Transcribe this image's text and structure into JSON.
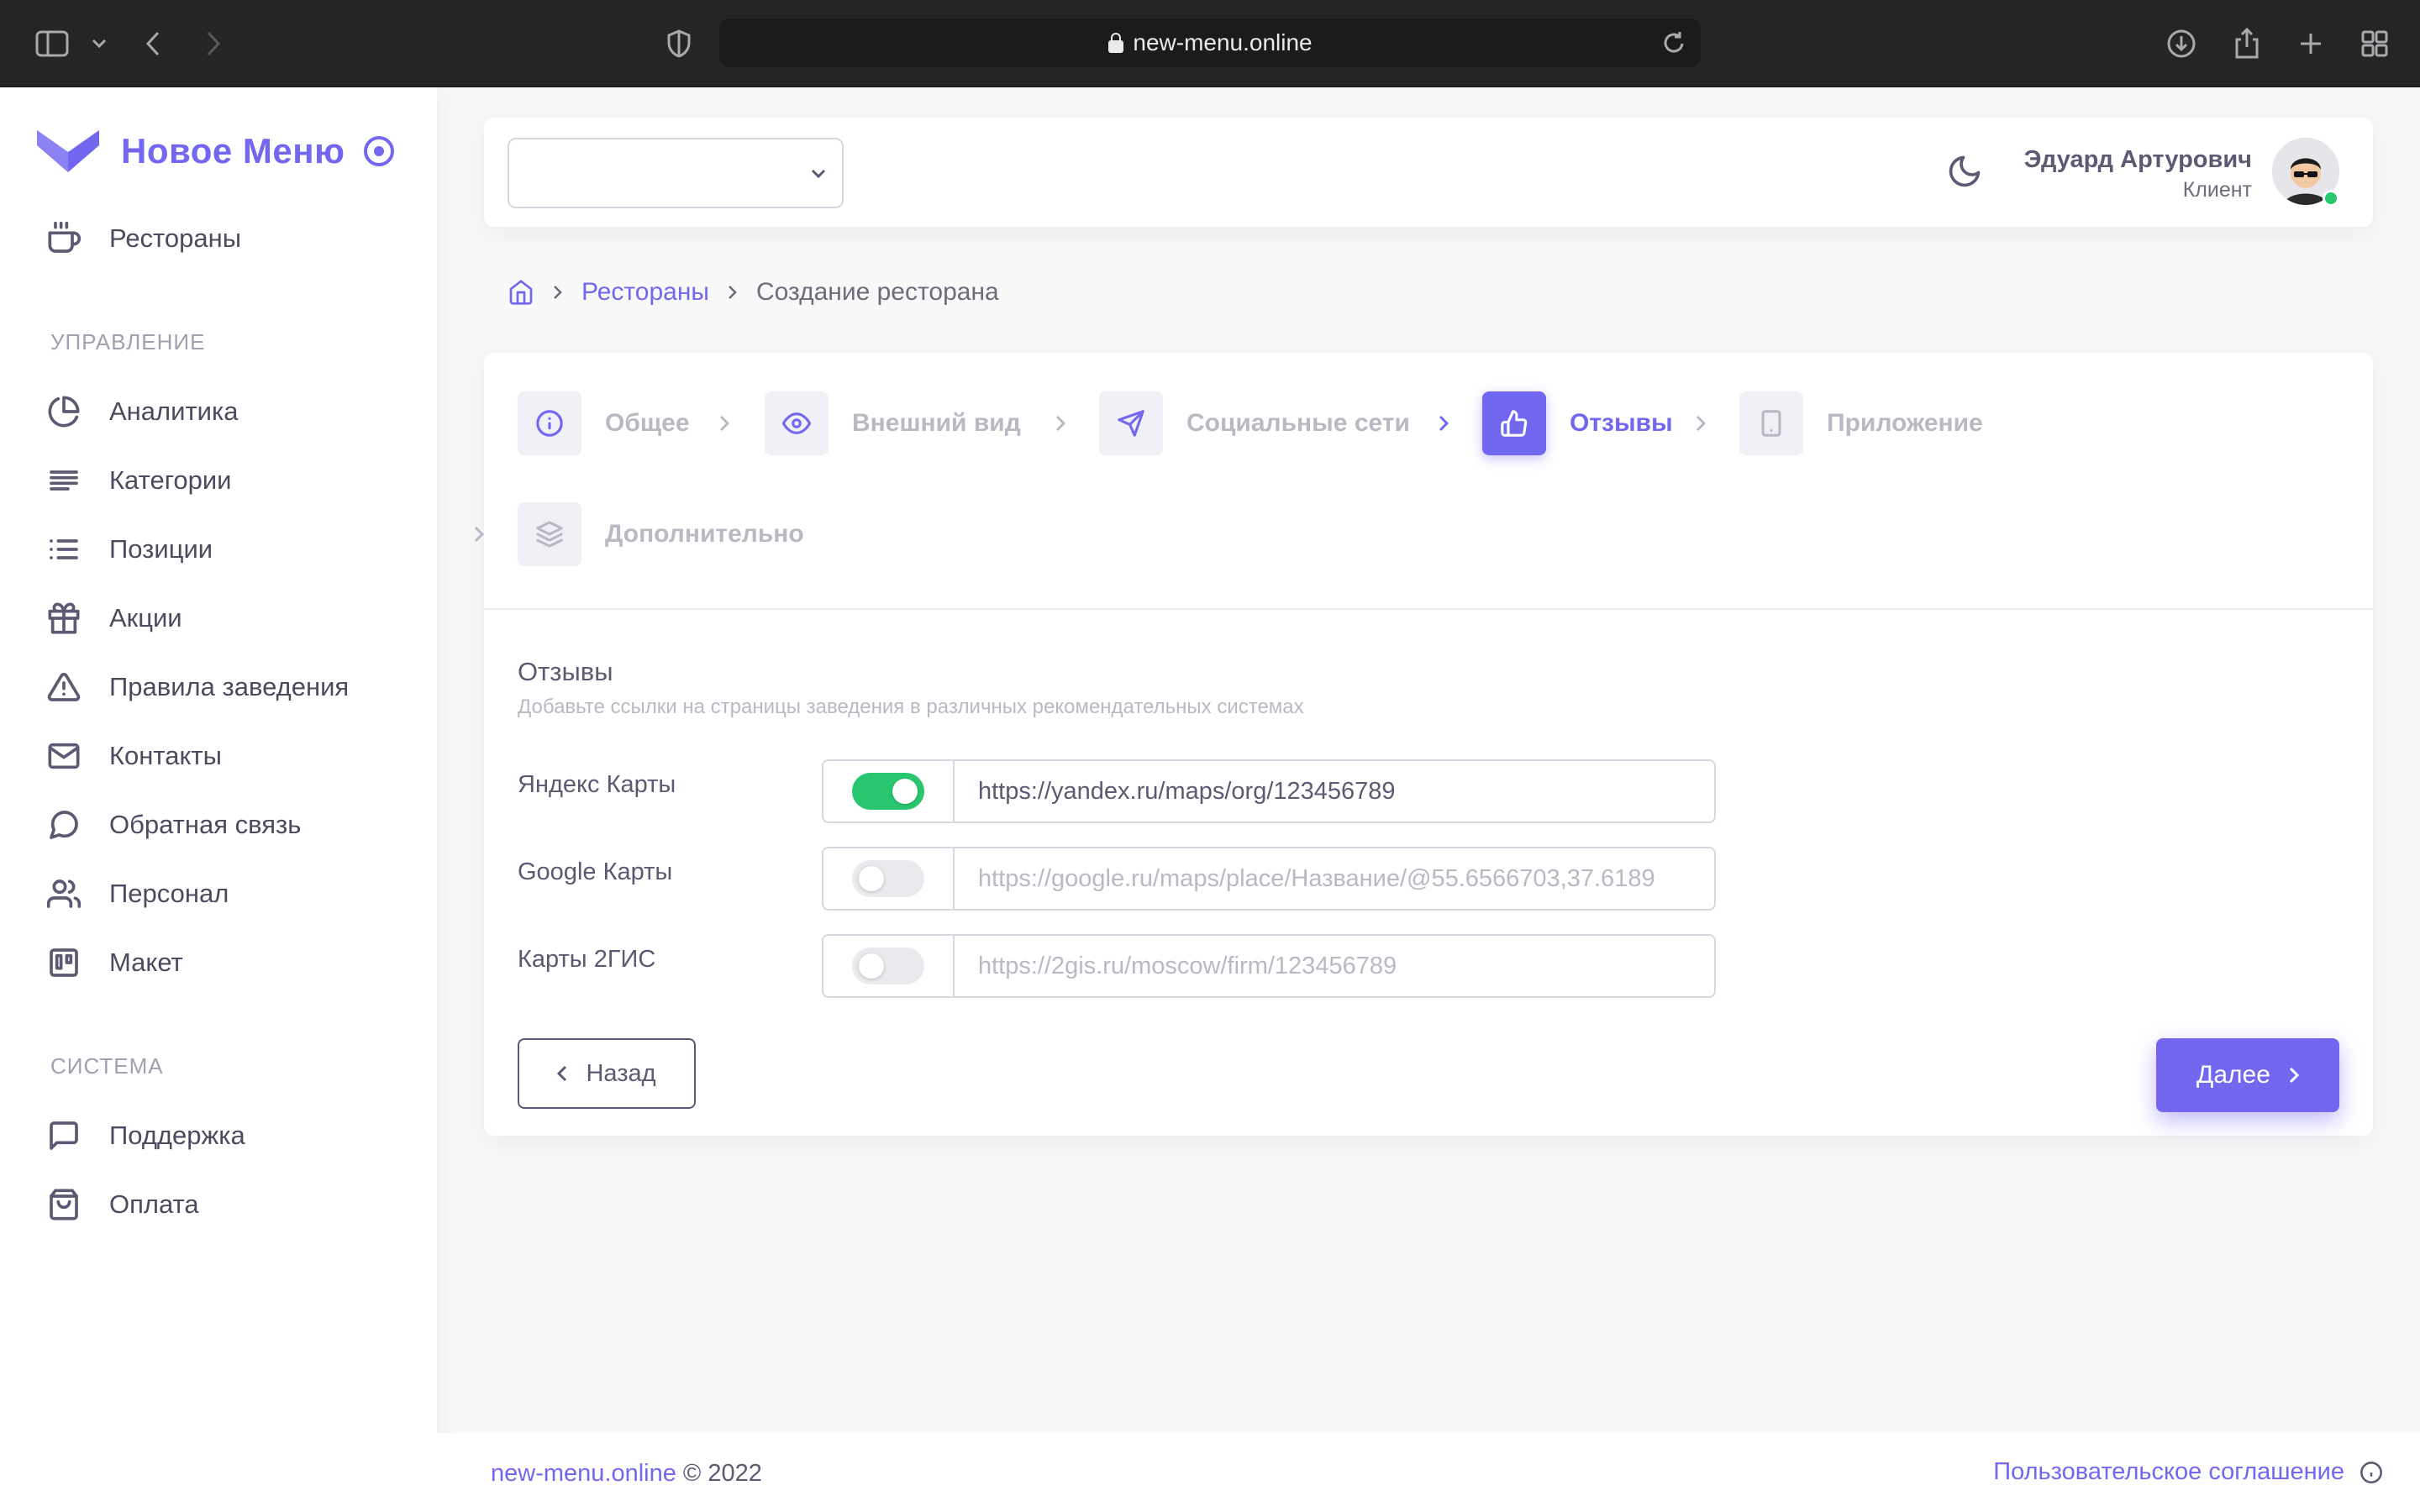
{
  "browser": {
    "url": "new-menu.online"
  },
  "sidebar": {
    "brand": "Новое Меню",
    "top_items": [
      {
        "label": "Рестораны",
        "icon": "coffee-icon"
      }
    ],
    "section_manage": "УПРАВЛЕНИЕ",
    "manage_items": [
      {
        "label": "Аналитика",
        "icon": "pie-chart-icon"
      },
      {
        "label": "Категории",
        "icon": "align-left-icon"
      },
      {
        "label": "Позиции",
        "icon": "list-icon"
      },
      {
        "label": "Акции",
        "icon": "gift-icon"
      },
      {
        "label": "Правила заведения",
        "icon": "alert-triangle-icon"
      },
      {
        "label": "Контакты",
        "icon": "mail-icon"
      },
      {
        "label": "Обратная связь",
        "icon": "message-circle-icon"
      },
      {
        "label": "Персонал",
        "icon": "users-icon"
      },
      {
        "label": "Макет",
        "icon": "trello-icon"
      }
    ],
    "section_system": "СИСТЕМА",
    "system_items": [
      {
        "label": "Поддержка",
        "icon": "message-square-icon"
      },
      {
        "label": "Оплата",
        "icon": "shopping-bag-icon"
      }
    ]
  },
  "header": {
    "select_value": "",
    "user_name": "Эдуард Артурович",
    "user_role": "Клиент"
  },
  "breadcrumb": {
    "parent": "Рестораны",
    "current": "Создание ресторана"
  },
  "stepper": {
    "steps": [
      {
        "label": "Общее",
        "icon": "info-icon",
        "state": "done"
      },
      {
        "label": "Внешний вид",
        "icon": "eye-icon",
        "state": "done"
      },
      {
        "label": "Социальные сети",
        "icon": "send-icon",
        "state": "done"
      },
      {
        "label": "Отзывы",
        "icon": "thumbs-up-icon",
        "state": "active"
      },
      {
        "label": "Приложение",
        "icon": "smartphone-icon",
        "state": "inactive"
      },
      {
        "label": "Дополнительно",
        "icon": "layers-icon",
        "state": "inactive"
      }
    ]
  },
  "form": {
    "title": "Отзывы",
    "subtitle": "Добавьте ссылки на страницы заведения в различных рекомендательных системах",
    "rows": [
      {
        "label": "Яндекс Карты",
        "enabled": true,
        "value": "https://yandex.ru/maps/org/123456789",
        "placeholder": ""
      },
      {
        "label": "Google Карты",
        "enabled": false,
        "value": "",
        "placeholder": "https://google.ru/maps/place/Название/@55.6566703,37.6189"
      },
      {
        "label": "Карты 2ГИС",
        "enabled": false,
        "value": "",
        "placeholder": "https://2gis.ru/moscow/firm/123456789"
      }
    ],
    "back_label": "Назад",
    "next_label": "Далее"
  },
  "footer": {
    "site": "new-menu.online",
    "copyright": "© 2022",
    "agreement": "Пользовательское соглашение"
  },
  "colors": {
    "accent": "#7367f0",
    "success": "#28c76f",
    "text": "#5e5873",
    "muted": "#b9b9c3"
  }
}
